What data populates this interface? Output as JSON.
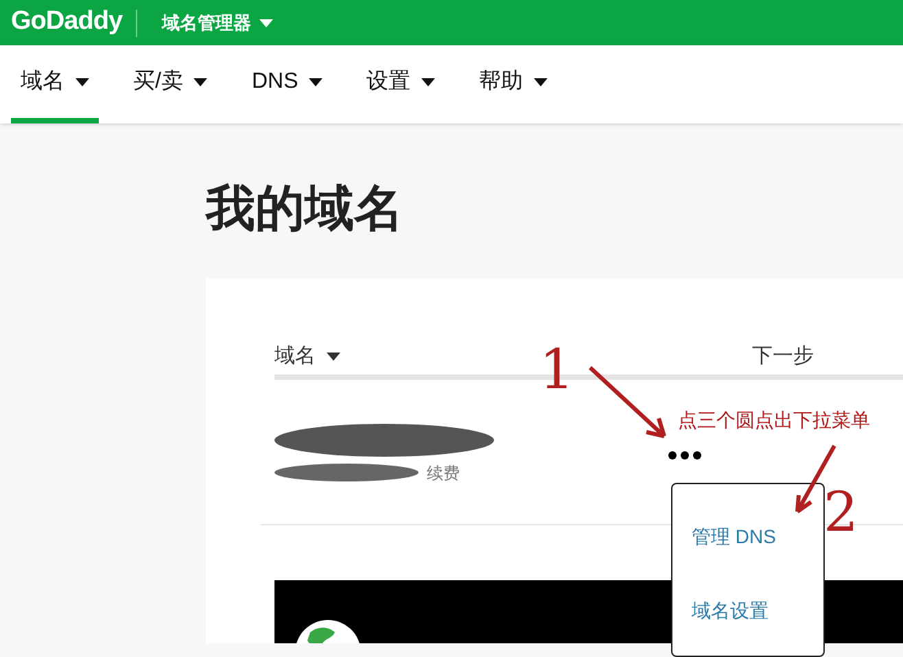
{
  "header": {
    "logo": "GoDaddy",
    "product_menu": "域名管理器"
  },
  "nav_tabs": [
    {
      "label": "域名",
      "selected": true
    },
    {
      "label": "买/卖",
      "selected": false
    },
    {
      "label": "DNS",
      "selected": false
    },
    {
      "label": "设置",
      "selected": false
    },
    {
      "label": "帮助",
      "selected": false
    }
  ],
  "page_title": "我的域名",
  "table": {
    "columns": [
      "域名",
      "下一步"
    ],
    "rows": [
      {
        "renew_link": "续费"
      }
    ]
  },
  "dropdown_menu": [
    "管理 DNS",
    "域名设置"
  ],
  "annotations": [
    {
      "kind": "number",
      "text": "1"
    },
    {
      "kind": "note",
      "text": "点三个圆点出下拉菜单"
    },
    {
      "kind": "number",
      "text": "2"
    }
  ]
}
